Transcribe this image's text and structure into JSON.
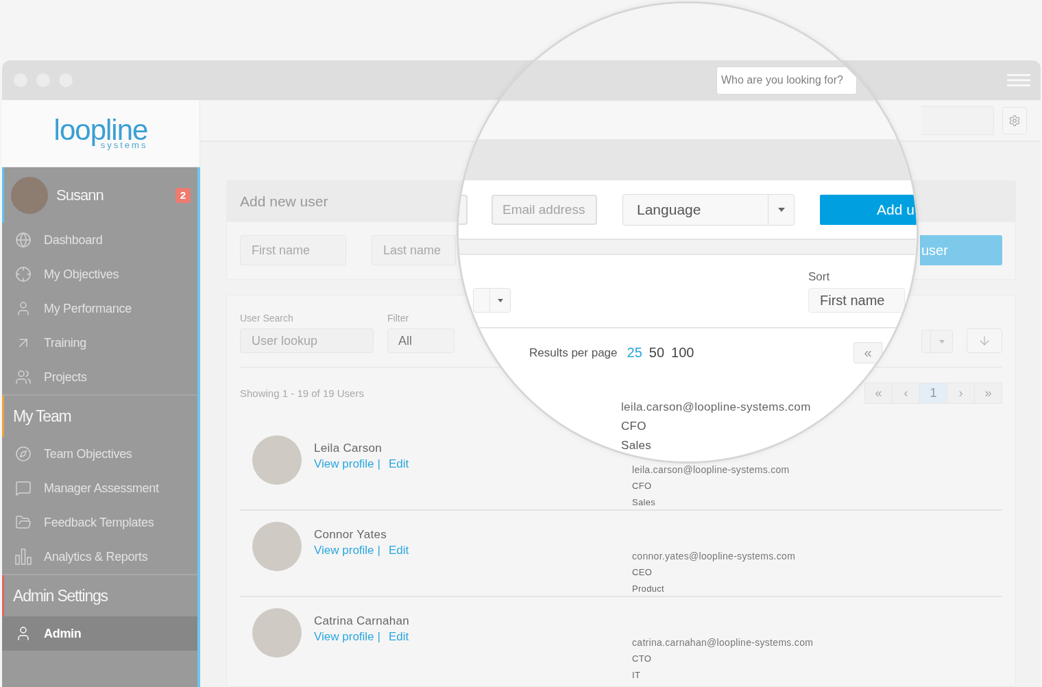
{
  "sidebar": {
    "logo": {
      "word": "loopline",
      "tagline": "systems"
    },
    "user": {
      "name": "Susann",
      "badge": "2"
    },
    "sections": [
      {
        "items": [
          {
            "label": "Dashboard",
            "selected": false
          },
          {
            "label": "My Objectives",
            "selected": false
          },
          {
            "label": "My Performance",
            "selected": false
          },
          {
            "label": "Training",
            "selected": false
          },
          {
            "label": "Projects",
            "selected": false
          }
        ]
      },
      {
        "title": "My Team",
        "color": "#e8a33d",
        "items": [
          {
            "label": "Team Objectives",
            "selected": false
          },
          {
            "label": "Manager Assessment",
            "selected": false
          },
          {
            "label": "Feedback Templates",
            "selected": false
          },
          {
            "label": "Analytics & Reports",
            "selected": false
          }
        ]
      },
      {
        "title": "Admin Settings",
        "color": "#e0675c",
        "items": [
          {
            "label": "Admin",
            "selected": true
          }
        ]
      }
    ]
  },
  "add_user_panel": {
    "title": "Add new user",
    "fields": [
      {
        "placeholder": "First name"
      },
      {
        "placeholder": "Last name"
      }
    ],
    "button": "user"
  },
  "users_panel": {
    "search": {
      "label": "User Search",
      "placeholder": "User lookup"
    },
    "filter": {
      "label": "Filter",
      "value": "All"
    },
    "summary": "Showing 1 - 19 of 19 Users",
    "pagination": [
      {
        "label": "«",
        "selected": false
      },
      {
        "label": "‹",
        "selected": false
      },
      {
        "label": "1",
        "selected": true
      },
      {
        "label": "›",
        "selected": false
      },
      {
        "label": "»",
        "selected": false
      }
    ],
    "users": [
      {
        "name": "Leila Carson",
        "links": [
          "View profile",
          "Edit"
        ],
        "separator": "|",
        "email": "leila.carson@loopline-systems.com",
        "position": "CFO",
        "department": "Sales"
      },
      {
        "name": "Connor Yates",
        "links": [
          "View profile",
          "Edit"
        ],
        "separator": "|",
        "email": "connor.yates@loopline-systems.com",
        "position": "CEO",
        "department": "Product"
      },
      {
        "name": "Catrina Carnahan",
        "links": [
          "View profile",
          "Edit"
        ],
        "separator": "|",
        "email": "catrina.carnahan@loopline-systems.com",
        "position": "CTO",
        "department": "IT"
      }
    ]
  },
  "magnifier": {
    "search": {
      "placeholder": "Who are you looking for?"
    },
    "email_field": {
      "placeholder": "Email address"
    },
    "language": {
      "value": "Language"
    },
    "add_button": "Add u",
    "sort": {
      "label": "Sort",
      "value": "First name"
    },
    "per_page": {
      "label": "Results per page",
      "options": [
        {
          "label": "25",
          "selected": true
        },
        {
          "label": "50",
          "selected": false
        },
        {
          "label": "100",
          "selected": false
        }
      ]
    },
    "first_page_button": "«",
    "user": {
      "email": "leila.carson@loopline-systems.com",
      "position": "CFO",
      "department": "Sales"
    }
  }
}
